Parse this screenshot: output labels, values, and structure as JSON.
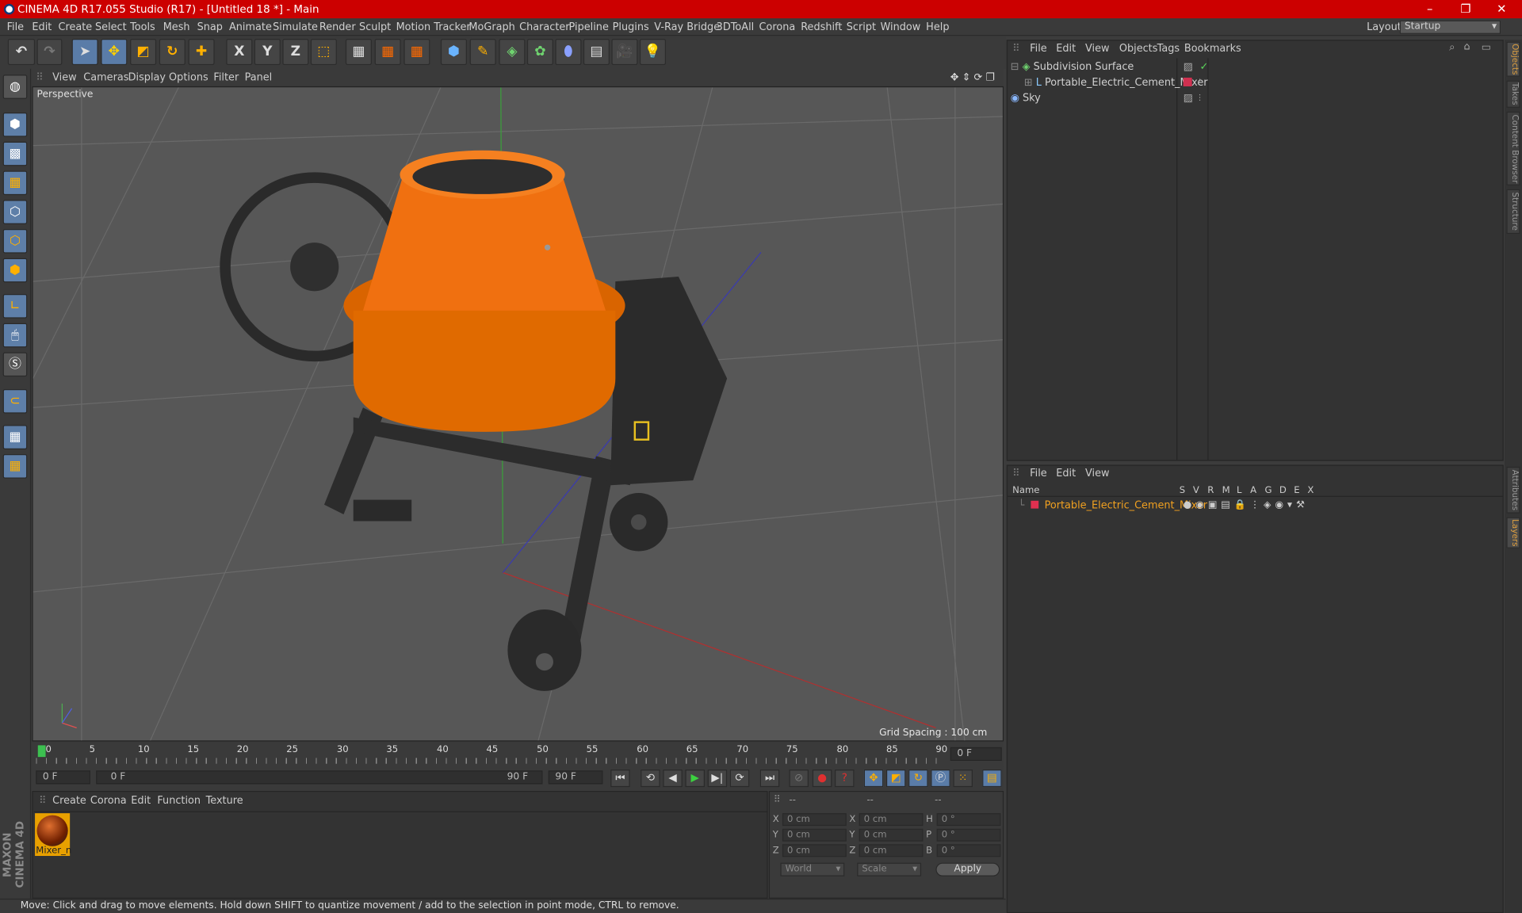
{
  "window": {
    "title": "CINEMA 4D R17.055 Studio (R17) - [Untitled 18 *] - Main",
    "controls": [
      "–",
      "❐",
      "✕"
    ]
  },
  "menu": [
    "File",
    "Edit",
    "Create",
    "Select",
    "Tools",
    "Mesh",
    "Snap",
    "Animate",
    "Simulate",
    "Render",
    "Sculpt",
    "Motion Tracker",
    "MoGraph",
    "Character",
    "Pipeline",
    "Plugins",
    "V-Ray Bridge",
    "3DToAll",
    "Corona",
    "Redshift",
    "Script",
    "Window",
    "Help"
  ],
  "layout": {
    "label": "Layout:",
    "value": "Startup"
  },
  "toolbar": {
    "x": "X",
    "y": "Y",
    "z": "Z"
  },
  "viewport": {
    "menu": [
      "View",
      "Cameras",
      "Display",
      "Options",
      "Filter",
      "Panel"
    ],
    "label": "Perspective",
    "grid_spacing": "Grid Spacing : 100 cm"
  },
  "timeline": {
    "ticks": [
      "0",
      "5",
      "10",
      "15",
      "20",
      "25",
      "30",
      "35",
      "40",
      "45",
      "50",
      "55",
      "60",
      "65",
      "70",
      "75",
      "80",
      "85",
      "90"
    ],
    "current": "0 F",
    "start": "0 F",
    "range_start": "0 F",
    "range_end": "90 F",
    "end": "90 F"
  },
  "materials": {
    "menu": [
      "Create",
      "Corona",
      "Edit",
      "Function",
      "Texture"
    ],
    "items": [
      {
        "name": "Mixer_n"
      }
    ]
  },
  "coords": {
    "headers": [
      "--",
      "--",
      "--"
    ],
    "rows": [
      {
        "a": "X",
        "av": "0 cm",
        "b": "X",
        "bv": "0 cm",
        "c": "H",
        "cv": "0 °"
      },
      {
        "a": "Y",
        "av": "0 cm",
        "b": "Y",
        "bv": "0 cm",
        "c": "P",
        "cv": "0 °"
      },
      {
        "a": "Z",
        "av": "0 cm",
        "b": "Z",
        "bv": "0 cm",
        "c": "B",
        "cv": "0 °"
      }
    ],
    "world": "World",
    "scale": "Scale",
    "apply": "Apply"
  },
  "status": "Move: Click and drag to move elements. Hold down SHIFT to quantize movement / add to the selection in point mode, CTRL to remove.",
  "objects": {
    "menu": [
      "File",
      "Edit",
      "View",
      "Objects",
      "Tags",
      "Bookmarks"
    ],
    "items": [
      {
        "name": "Subdivision Surface"
      },
      {
        "name": "Portable_Electric_Cement_Mixer"
      },
      {
        "name": "Sky"
      }
    ]
  },
  "layers": {
    "menu": [
      "File",
      "Edit",
      "View"
    ],
    "columns": [
      "Name",
      "S",
      "V",
      "R",
      "M",
      "L",
      "A",
      "G",
      "D",
      "E",
      "X"
    ],
    "items": [
      {
        "name": "Portable_Electric_Cement_Mixer",
        "color": "#e03050"
      }
    ]
  },
  "side_tabs": [
    "Objects",
    "Takes",
    "Content Browser",
    "Structure",
    "Attributes",
    "Layers"
  ],
  "brand": "MAXON CINEMA 4D"
}
